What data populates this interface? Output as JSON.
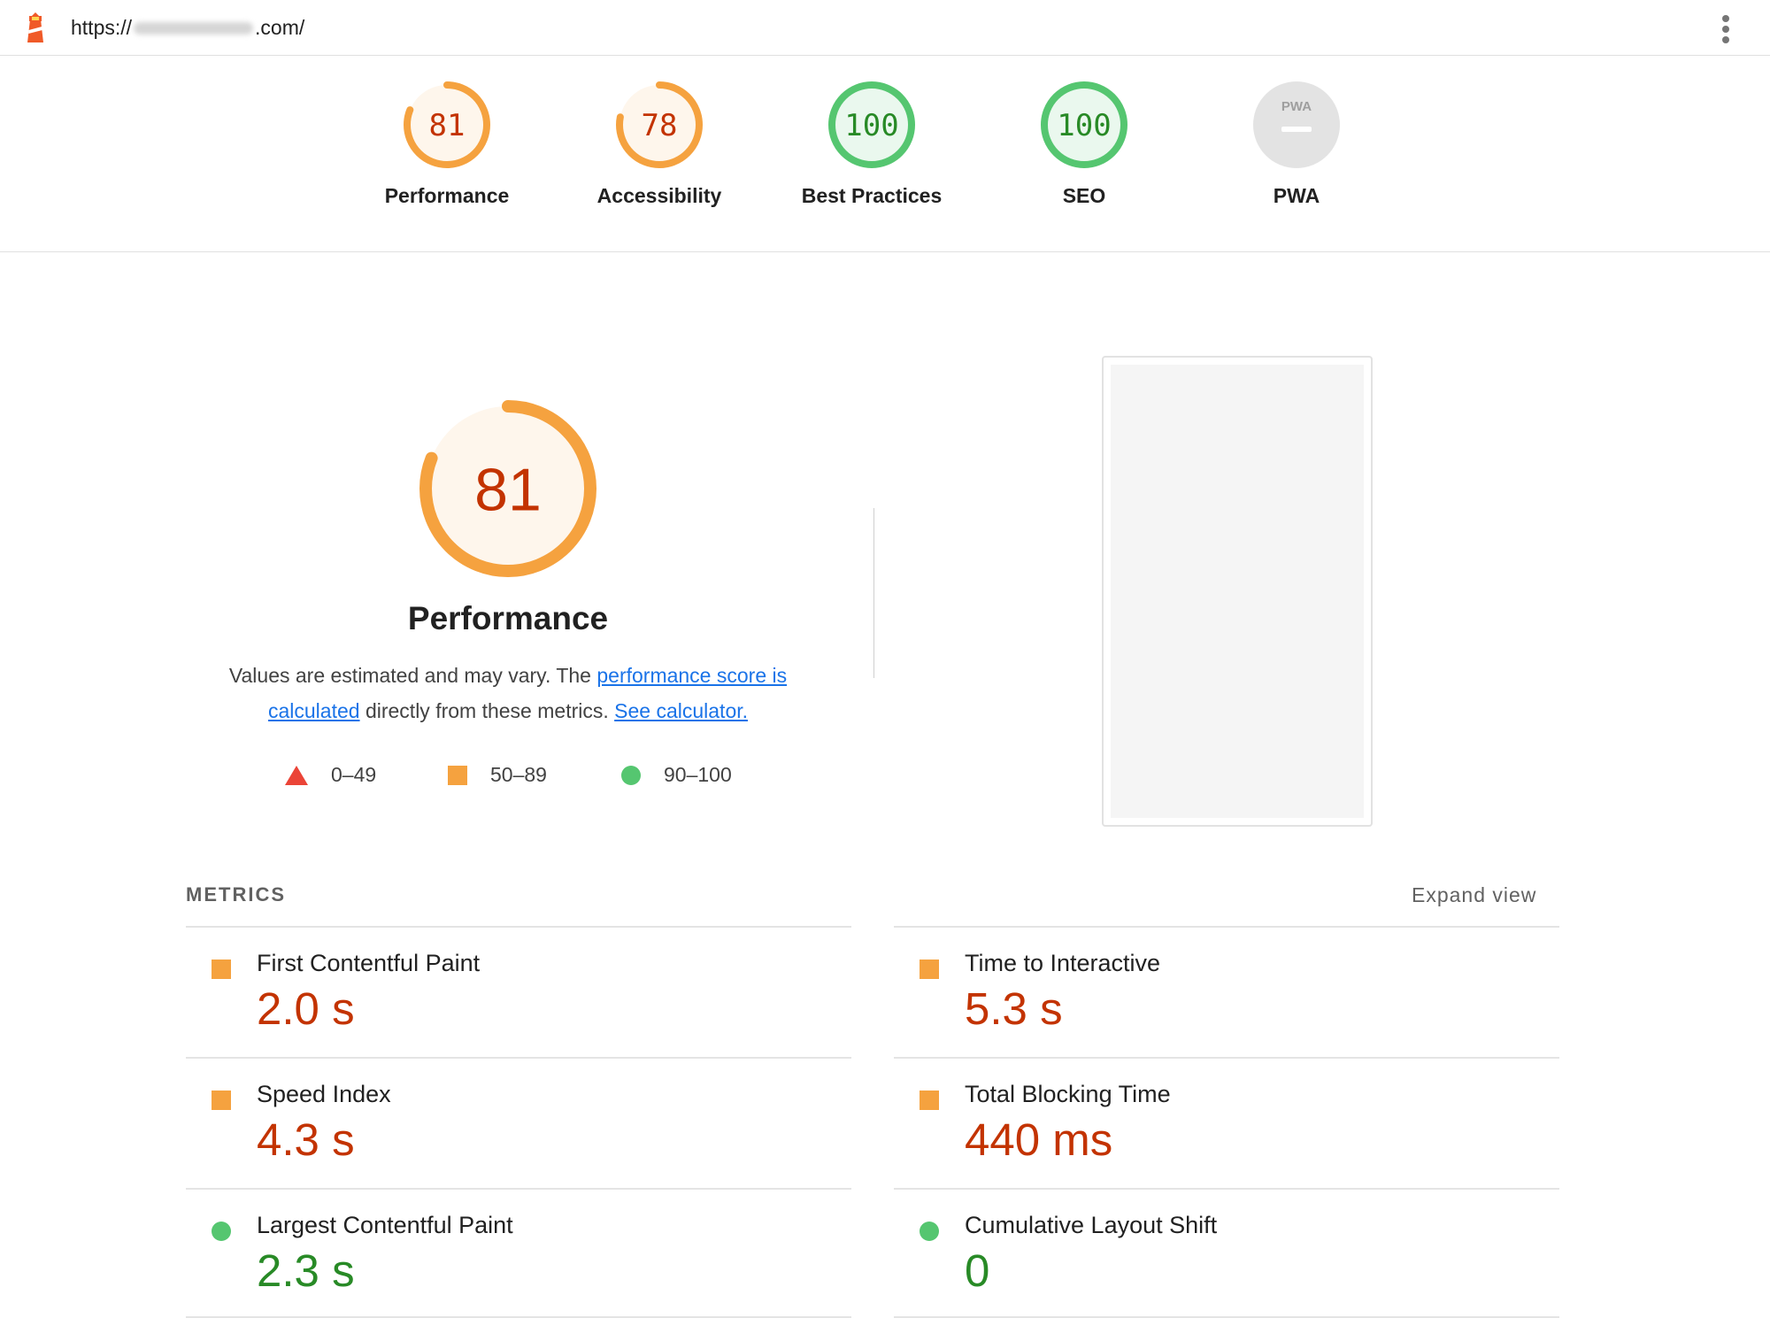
{
  "browser": {
    "url_prefix": "https://",
    "url_suffix": ".com/",
    "logo_icon": "lighthouse-icon",
    "menu_icon": "kebab-menu-icon"
  },
  "summary": [
    {
      "label": "Performance",
      "score": "81",
      "fraction": 0.81,
      "status": "average"
    },
    {
      "label": "Accessibility",
      "score": "78",
      "fraction": 0.78,
      "status": "average"
    },
    {
      "label": "Best Practices",
      "score": "100",
      "fraction": 1.0,
      "status": "pass"
    },
    {
      "label": "SEO",
      "score": "100",
      "fraction": 1.0,
      "status": "pass"
    },
    {
      "label": "PWA",
      "badge": "PWA",
      "status": "na"
    }
  ],
  "performance": {
    "score": "81",
    "fraction": 0.81,
    "title": "Performance",
    "desc_part1": "Values are estimated and may vary. The ",
    "desc_link1": "performance score is calculated",
    "desc_part2": " directly from these metrics. ",
    "desc_link2": "See calculator."
  },
  "legend": [
    {
      "shape": "triangle",
      "range": "0–49"
    },
    {
      "shape": "square",
      "range": "50–89"
    },
    {
      "shape": "circle",
      "range": "90–100"
    }
  ],
  "metrics": {
    "header": "METRICS",
    "expand_label": "Expand view",
    "items": [
      {
        "name": "First Contentful Paint",
        "value": "2.0 s",
        "status": "average"
      },
      {
        "name": "Time to Interactive",
        "value": "5.3 s",
        "status": "average"
      },
      {
        "name": "Speed Index",
        "value": "4.3 s",
        "status": "average"
      },
      {
        "name": "Total Blocking Time",
        "value": "440 ms",
        "status": "average"
      },
      {
        "name": "Largest Contentful Paint",
        "value": "2.3 s",
        "status": "pass"
      },
      {
        "name": "Cumulative Layout Shift",
        "value": "0",
        "status": "pass"
      }
    ]
  },
  "colors": {
    "average_ring": "#f5a23f",
    "average_fill": "#fef6ec",
    "average_text": "#c33300",
    "pass_ring": "#55c670",
    "pass_fill": "#eaf8ee",
    "pass_text": "#288a26",
    "fail": "#eb4437",
    "na_fill": "#e3e3e3",
    "na_text": "#9e9e9e"
  }
}
